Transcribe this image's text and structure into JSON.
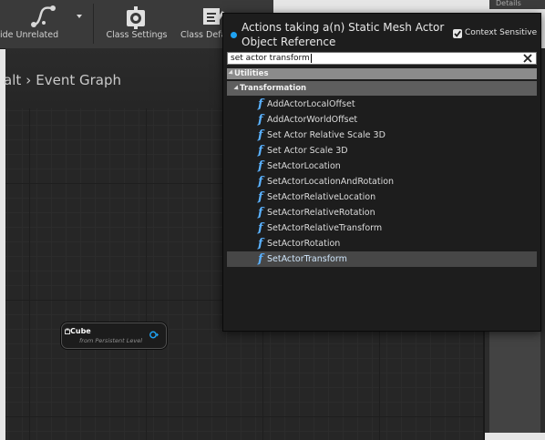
{
  "toolbar": {
    "hide_unrelated_label": "ide Unrelated",
    "class_settings_label": "Class Settings",
    "class_defaults_label": "Class Defa"
  },
  "details_tab": {
    "label": "Details"
  },
  "graph": {
    "breadcrumb_prev": "alt",
    "breadcrumb_current": "Event Graph"
  },
  "node": {
    "title": "Cube",
    "subtitle": "from Persistent Level"
  },
  "action_menu": {
    "title_line1": "Actions taking a(n) Static Mesh Actor",
    "title_line2": "Object Reference",
    "context_sensitive_label": "Context Sensitive",
    "context_sensitive_checked": true,
    "search_value": "set actor transform",
    "categories": [
      {
        "label": "Utilities"
      },
      {
        "label": "Transformation"
      }
    ],
    "items": [
      {
        "label": "AddActorLocalOffset"
      },
      {
        "label": "AddActorWorldOffset"
      },
      {
        "label": "Set Actor Relative Scale 3D"
      },
      {
        "label": "Set Actor Scale 3D"
      },
      {
        "label": "SetActorLocation"
      },
      {
        "label": "SetActorLocationAndRotation"
      },
      {
        "label": "SetActorRelativeLocation"
      },
      {
        "label": "SetActorRelativeRotation"
      },
      {
        "label": "SetActorRelativeTransform"
      },
      {
        "label": "SetActorRotation"
      },
      {
        "label": "SetActorTransform",
        "selected": true
      }
    ],
    "function_icon": "f",
    "accent_color": "#1fa3f3"
  }
}
